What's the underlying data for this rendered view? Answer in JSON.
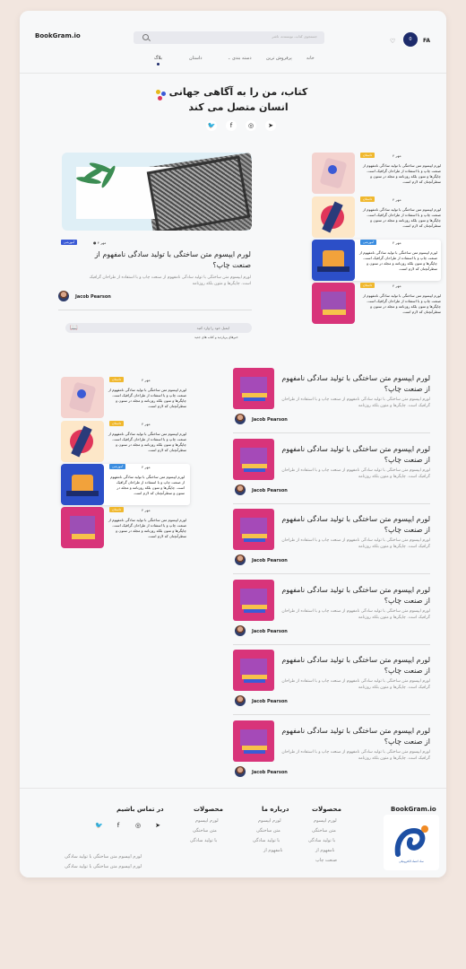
{
  "header": {
    "brand": "BookGram.io",
    "search_placeholder": "جستجوی کتاب، نویسنده، ناشر",
    "cart_count": "0",
    "lang": "FA",
    "nav": [
      "خانه",
      "پرفروش ترین",
      "دسته بندی",
      "داستان",
      "بلاگ"
    ]
  },
  "hero": {
    "title": "کتاب، من را به آگاهی جهانی انسان متصل می کند",
    "dot_colors": [
      "#e6b81a",
      "#3b5bd6",
      "#e0365a"
    ]
  },
  "featured": {
    "meta_date": "۴ مهر",
    "tag": "آموزشی",
    "title": "لورم ایپسوم متن ساختگی با تولید سادگی نامفهوم از صنعت چاپ؟",
    "excerpt": "لورم ایپسوم متن ساختگی با تولید سادگی نامفهوم از صنعت چاپ و با استفاده از طراحان گرافیک است. چاپگرها و متون بلکه روزنامه",
    "author": "Jacob Pearson"
  },
  "newsletter": {
    "placeholder": "ایمیل خود را وارد کنید",
    "note": "خبرهای پربازدید و کتاب های جدید"
  },
  "side_cards": [
    {
      "date": "۴ مهر",
      "tag": "داستان",
      "tag_color": "#f0b82e",
      "text": "لورم ایپسوم متن ساختگی با تولید سادگی نامفهوم از صنعت چاپ و با استفاده از طراحان گرافیک است. چاپگرها و متون بلکه روزنامه و مجله در ستون و سطرآنچنان که لازم است."
    },
    {
      "date": "۴ مهر",
      "tag": "داستان",
      "tag_color": "#f0b82e",
      "text": "لورم ایپسوم متن ساختگی با تولید سادگی نامفهوم از صنعت چاپ و با استفاده از طراحان گرافیک است. چاپگرها و متون بلکه روزنامه و مجله در ستون و سطرآنچنان که لازم است."
    },
    {
      "date": "۴ مهر",
      "tag": "آموزشی",
      "tag_color": "#3b8de0",
      "text": "لورم ایپسوم متن ساختگی با تولید سادگی نامفهوم از صنعت چاپ و با استفاده از طراحان گرافیک است. چاپگرها و متون بلکه روزنامه و مجله در ستون و سطرآنچنان که لازم است."
    },
    {
      "date": "۴ مهر",
      "tag": "داستان",
      "tag_color": "#f0b82e",
      "text": "لورم ایپسوم متن ساختگی با تولید سادگی نامفهوم از صنعت چاپ و با استفاده از طراحان گرافیک است. چاپگرها و متون بلکه روزنامه و مجله در ستون و سطرآنچنان که لازم است."
    }
  ],
  "articles": [
    {
      "title": "لورم ایپسوم متن ساختگی با تولید سادگی نامفهوم از صنعت چاپ؟",
      "excerpt": "لورم ایپسوم متن ساختگی با تولید سادگی نامفهوم از صنعت چاپ و با استفاده از طراحان گرافیک است. چاپگرها و متون بلکه روزنامه",
      "author": "Jacob Pearson"
    },
    {
      "title": "لورم ایپسوم متن ساختگی با تولید سادگی نامفهوم از صنعت چاپ؟",
      "excerpt": "لورم ایپسوم متن ساختگی با تولید سادگی نامفهوم از صنعت چاپ و با استفاده از طراحان گرافیک است. چاپگرها و متون بلکه روزنامه",
      "author": "Jacob Pearson"
    },
    {
      "title": "لورم ایپسوم متن ساختگی با تولید سادگی نامفهوم از صنعت چاپ؟",
      "excerpt": "لورم ایپسوم متن ساختگی با تولید سادگی نامفهوم از صنعت چاپ و با استفاده از طراحان گرافیک است. چاپگرها و متون بلکه روزنامه",
      "author": "Jacob Pearson"
    },
    {
      "title": "لورم ایپسوم متن ساختگی با تولید سادگی نامفهوم از صنعت چاپ؟",
      "excerpt": "لورم ایپسوم متن ساختگی با تولید سادگی نامفهوم از صنعت چاپ و با استفاده از طراحان گرافیک است. چاپگرها و متون بلکه روزنامه",
      "author": "Jacob Pearson"
    },
    {
      "title": "لورم ایپسوم متن ساختگی با تولید سادگی نامفهوم از صنعت چاپ؟",
      "excerpt": "لورم ایپسوم متن ساختگی با تولید سادگی نامفهوم از صنعت چاپ و با استفاده از طراحان گرافیک است. چاپگرها و متون بلکه روزنامه",
      "author": "Jacob Pearson"
    },
    {
      "title": "لورم ایپسوم متن ساختگی با تولید سادگی نامفهوم از صنعت چاپ؟",
      "excerpt": "لورم ایپسوم متن ساختگی با تولید سادگی نامفهوم از صنعت چاپ و با استفاده از طراحان گرافیک است. چاپگرها و متون بلکه روزنامه",
      "author": "Jacob Pearson"
    }
  ],
  "footer": {
    "brand": "BookGram.io",
    "logo_caption": "نماد اعتماد الکترونیکی",
    "col1": {
      "title": "محصولات",
      "links": [
        "لورم ایپسوم",
        "متن ساختگی",
        "با تولید سادگی",
        "نامفهوم از",
        "صنعت چاپ"
      ]
    },
    "col2": {
      "title": "درباره ما",
      "links": [
        "لورم ایپسوم",
        "متن ساختگی",
        "با تولید سادگی",
        "نامفهوم از"
      ]
    },
    "col3": {
      "title": "محصولات",
      "links": [
        "لورم ایپسوم",
        "متن ساختگی",
        "با تولید سادگی"
      ]
    },
    "col4": {
      "title": "در تماس باشیم"
    },
    "notes": [
      "لورم ایپسوم متن ساختگی با تولید سادگی",
      "لورم ایپسوم متن ساختگی با تولید سادگی"
    ]
  }
}
